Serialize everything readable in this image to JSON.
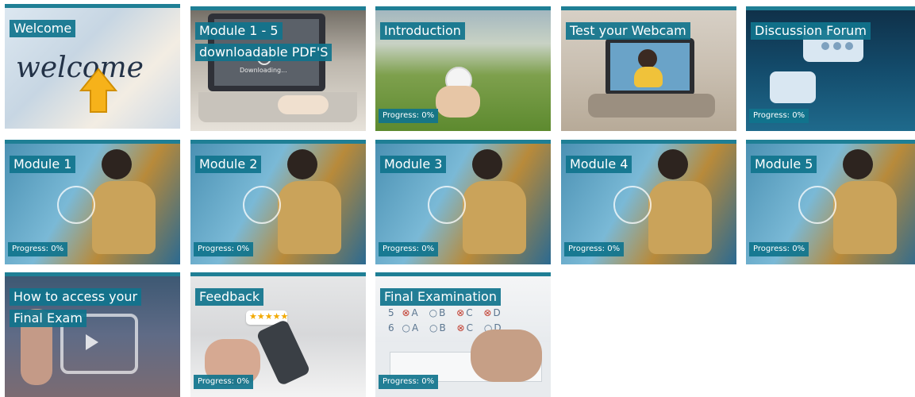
{
  "tiles": [
    {
      "title": "Welcome",
      "progress": "",
      "image_text": "welcome",
      "type": "welcome"
    },
    {
      "title": "Module 1 - 5 downloadable PDF'S",
      "progress": "",
      "image_text": "Downloading...",
      "type": "pdf"
    },
    {
      "title": "Introduction",
      "progress": "Progress: 0%",
      "type": "intro"
    },
    {
      "title": "Test your Webcam",
      "progress": "",
      "type": "webcam"
    },
    {
      "title": "Discussion Forum",
      "progress": "Progress: 0%",
      "type": "forum"
    },
    {
      "title": "Module 1",
      "progress": "Progress: 0%",
      "type": "module"
    },
    {
      "title": "Module 2",
      "progress": "Progress: 0%",
      "type": "module"
    },
    {
      "title": "Module 3",
      "progress": "Progress: 0%",
      "type": "module"
    },
    {
      "title": "Module 4",
      "progress": "Progress: 0%",
      "type": "module"
    },
    {
      "title": "Module 5",
      "progress": "Progress: 0%",
      "type": "module"
    },
    {
      "title": "How to access your Final Exam",
      "progress": "",
      "type": "final-access"
    },
    {
      "title": "Feedback",
      "progress": "Progress: 0%",
      "type": "feedback"
    },
    {
      "title": "Final Examination",
      "progress": "Progress: 0%",
      "type": "exam"
    }
  ],
  "exam_rows": [
    {
      "num": "5",
      "a": "A",
      "b": "B",
      "c": "C",
      "d": "D"
    },
    {
      "num": "6",
      "a": "A",
      "b": "B",
      "c": "C",
      "d": "D"
    }
  ],
  "colors": {
    "accent": "#1f7f95",
    "label_bg": "#10748d",
    "arrow": "#f6b21a"
  }
}
